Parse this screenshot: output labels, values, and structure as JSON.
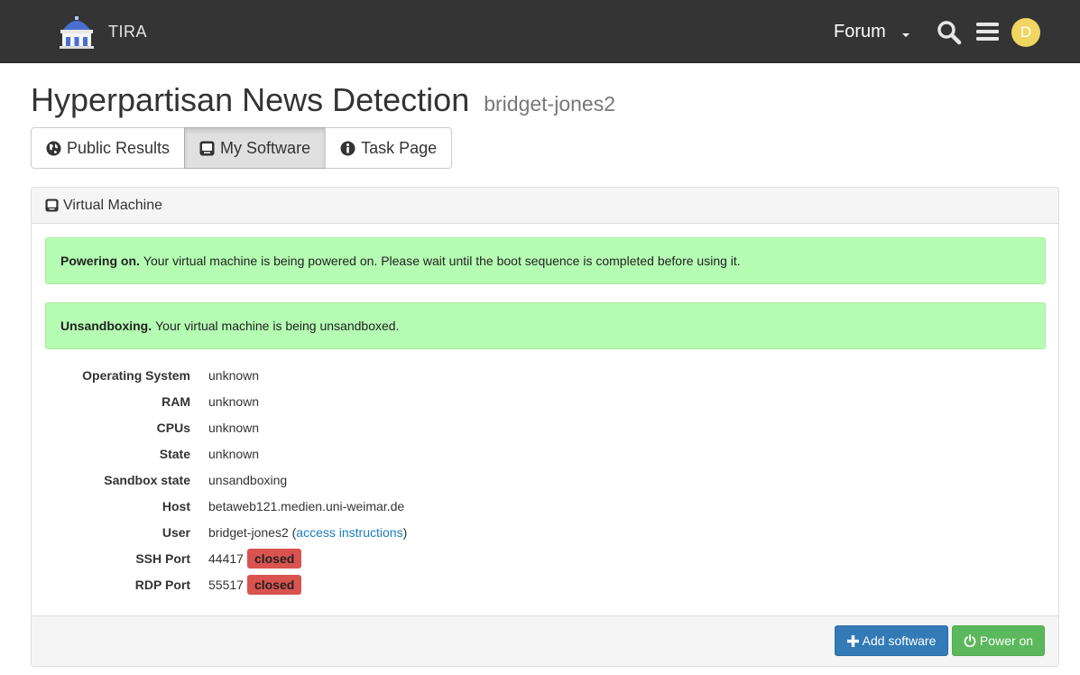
{
  "navbar": {
    "brand": "TIRA",
    "forum_label": "Forum",
    "avatar_letter": "D",
    "icons": [
      "building-logo-icon",
      "search-icon",
      "hamburger-menu-icon",
      "caret-down-icon"
    ]
  },
  "page": {
    "title": "Hyperpartisan News Detection",
    "subtitle": "bridget-jones2"
  },
  "tabs": [
    {
      "label": "Public Results",
      "icon": "globe-icon",
      "active": false
    },
    {
      "label": "My Software",
      "icon": "computer-icon",
      "active": true
    },
    {
      "label": "Task Page",
      "icon": "info-icon",
      "active": false
    }
  ],
  "panel": {
    "heading": "Virtual Machine",
    "alerts": [
      {
        "strong": "Powering on.",
        "text": "Your virtual machine is being powered on. Please wait until the boot sequence is completed before using it."
      },
      {
        "strong": "Unsandboxing.",
        "text": "Your virtual machine is being unsandboxed."
      }
    ],
    "info": {
      "os": {
        "label": "Operating System",
        "value": "unknown"
      },
      "ram": {
        "label": "RAM",
        "value": "unknown"
      },
      "cpus": {
        "label": "CPUs",
        "value": "unknown"
      },
      "state": {
        "label": "State",
        "value": "unknown"
      },
      "sandbox": {
        "label": "Sandbox state",
        "value": "unsandboxing"
      },
      "host": {
        "label": "Host",
        "value": "betaweb121.medien.uni-weimar.de"
      },
      "user": {
        "label": "User",
        "value": "bridget-jones2",
        "paren_open": "(",
        "link": "access instructions",
        "paren_close": ")"
      },
      "ssh": {
        "label": "SSH Port",
        "value": "44417",
        "status": "closed"
      },
      "rdp": {
        "label": "RDP Port",
        "value": "55517",
        "status": "closed"
      }
    },
    "footer": {
      "add_software": "Add software",
      "power_on": "Power on"
    }
  },
  "colors": {
    "navbar_bg": "#343434",
    "alert_bg": "#b5fdb3",
    "primary": "#337ab7",
    "success": "#5cb85c",
    "danger": "#d9534f",
    "link": "#1a7bc2"
  }
}
